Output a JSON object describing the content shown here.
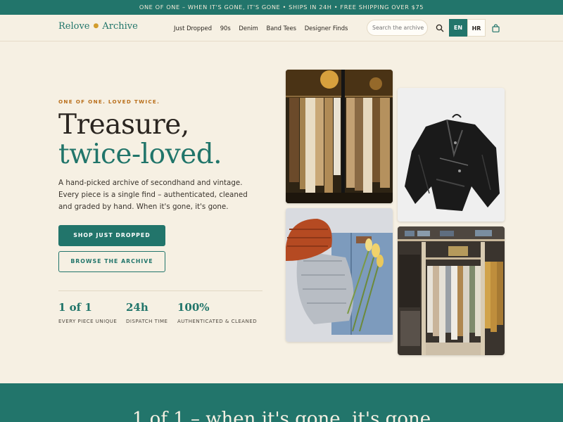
{
  "announcement": "ONE OF ONE – WHEN IT'S GONE, IT'S GONE • SHIPS IN 24H • FREE SHIPPING OVER $75",
  "brand": {
    "part1": "Relove",
    "part2": "Archive"
  },
  "nav": {
    "items": [
      "Just Dropped",
      "90s",
      "Denim",
      "Band Tees",
      "Designer Finds"
    ]
  },
  "search": {
    "placeholder": "Search the archive"
  },
  "languages": {
    "active": "EN",
    "other": "HR"
  },
  "hero": {
    "eyebrow": "ONE OF ONE. LOVED TWICE.",
    "title_line1": "Treasure,",
    "title_line2": "twice-loved.",
    "description": "A hand-picked archive of secondhand and vintage. Every piece is a single find – authenticated, cleaned and graded by hand. When it's gone, it's gone.",
    "primary_cta": "SHOP JUST DROPPED",
    "secondary_cta": "BROWSE THE ARCHIVE"
  },
  "stats": [
    {
      "value": "1 of 1",
      "label": "EVERY PIECE UNIQUE"
    },
    {
      "value": "24h",
      "label": "DISPATCH TIME"
    },
    {
      "value": "100%",
      "label": "AUTHENTICATED & CLEANED"
    }
  ],
  "band": {
    "title": "1 of 1 – when it's gone, it's gone"
  },
  "colors": {
    "accent": "#22756b",
    "background": "#f6f0e3",
    "eyebrow": "#b96f1b",
    "text": "#2b2620"
  }
}
